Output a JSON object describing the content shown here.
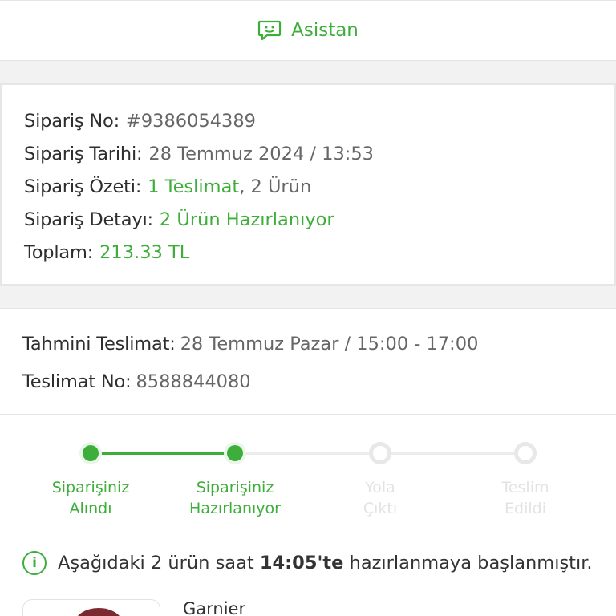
{
  "assistant": {
    "label": "Asistan",
    "icon": "chat-bubble-icon"
  },
  "order": {
    "no_label": "Sipariş No:",
    "no_value": "#9386054389",
    "date_label": "Sipariş Tarihi:",
    "date_value": "28 Temmuz 2024 / 13:53",
    "summary_label": "Sipariş Özeti:",
    "summary_deliveries": "1 Teslimat",
    "summary_sep": ",",
    "summary_products": " 2 Ürün",
    "detail_label": "Sipariş Detayı:",
    "detail_value": "2 Ürün Hazırlanıyor",
    "total_label": "Toplam:",
    "total_value": "213.33 TL"
  },
  "delivery": {
    "estimated_label": "Tahmini Teslimat:",
    "estimated_value": "28 Temmuz Pazar / 15:00 - 17:00",
    "no_label": "Teslimat No:",
    "no_value": "8588844080"
  },
  "tracker": {
    "steps": [
      {
        "line1": "Siparişiniz",
        "line2": "Alındı",
        "done": true
      },
      {
        "line1": "Siparişiniz",
        "line2": "Hazırlanıyor",
        "done": true
      },
      {
        "line1": "Yola",
        "line2": "Çıktı",
        "done": false
      },
      {
        "line1": "Teslim",
        "line2": "Edildi",
        "done": false
      }
    ]
  },
  "info": {
    "icon": "info-icon",
    "prefix": "Aşağıdaki 2 ürün saat ",
    "time": "14:05'te",
    "suffix": " hazırlanmaya başlanmıştır."
  },
  "product": {
    "name": "Garnier"
  },
  "colors": {
    "accent": "#3dae3a",
    "inactive": "#e3e3e3"
  }
}
